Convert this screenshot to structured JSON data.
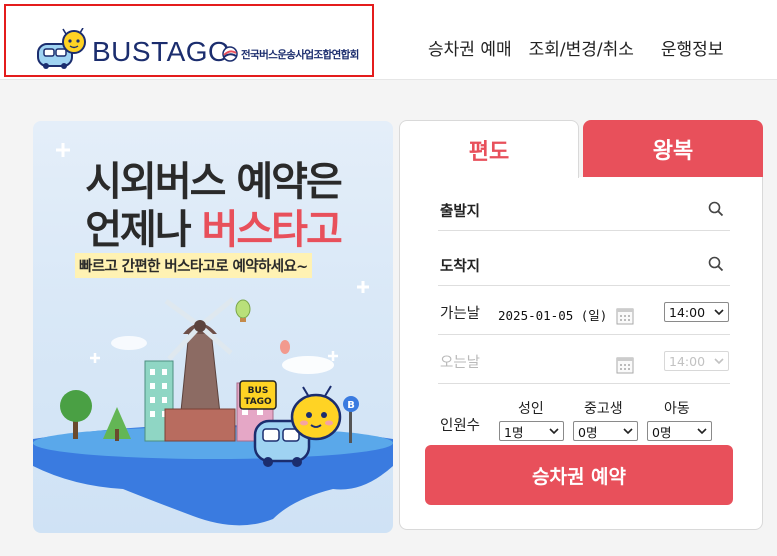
{
  "header": {
    "logo_text": "BUSTAGO",
    "association": "전국버스운송사업조합연합회",
    "nav": [
      "승차권 예매",
      "조회/변경/취소",
      "운행정보"
    ]
  },
  "banner": {
    "line1": "시외버스 예약은",
    "line2_prefix": "언제나 ",
    "line2_highlight": "버스타고",
    "subtitle": "빠르고 간편한 버스타고로 예약하세요~",
    "sign_top": "BUS",
    "sign_bottom": "TAGO",
    "stop_sign": "B"
  },
  "booking": {
    "tabs": {
      "one_way": "편도",
      "round_trip": "왕복"
    },
    "departure_label": "출발지",
    "arrival_label": "도착지",
    "go_date_label": "가는날",
    "go_date_value": "2025-01-05 (일)",
    "go_time": "14:00",
    "return_date_label": "오는날",
    "return_time": "14:00",
    "passengers_label": "인원수",
    "passenger_groups": [
      {
        "label": "성인",
        "value": "1명"
      },
      {
        "label": "중고생",
        "value": "0명"
      },
      {
        "label": "아동",
        "value": "0명"
      }
    ],
    "submit_label": "승차권 예약"
  },
  "colors": {
    "accent": "#e8505b",
    "brand_navy": "#1b2d6e",
    "highlight_border": "#e41c1c"
  },
  "icons": [
    "search-icon",
    "calendar-icon",
    "chevron-down-icon",
    "mascot-icon",
    "emblem-icon"
  ]
}
